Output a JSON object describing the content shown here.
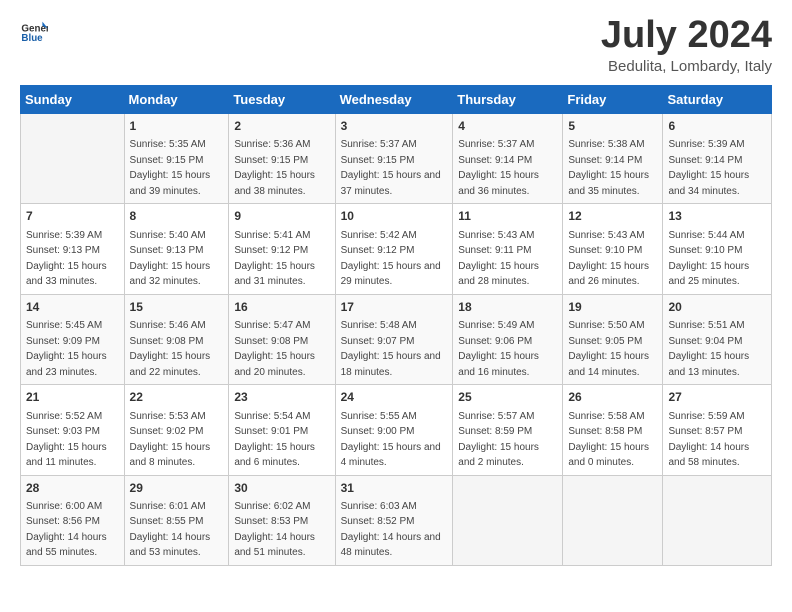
{
  "header": {
    "logo_general": "General",
    "logo_blue": "Blue",
    "month_title": "July 2024",
    "location": "Bedulita, Lombardy, Italy"
  },
  "days_of_week": [
    "Sunday",
    "Monday",
    "Tuesday",
    "Wednesday",
    "Thursday",
    "Friday",
    "Saturday"
  ],
  "weeks": [
    [
      {
        "num": "",
        "sunrise": "",
        "sunset": "",
        "daylight": "",
        "empty": true
      },
      {
        "num": "1",
        "sunrise": "Sunrise: 5:35 AM",
        "sunset": "Sunset: 9:15 PM",
        "daylight": "Daylight: 15 hours and 39 minutes."
      },
      {
        "num": "2",
        "sunrise": "Sunrise: 5:36 AM",
        "sunset": "Sunset: 9:15 PM",
        "daylight": "Daylight: 15 hours and 38 minutes."
      },
      {
        "num": "3",
        "sunrise": "Sunrise: 5:37 AM",
        "sunset": "Sunset: 9:15 PM",
        "daylight": "Daylight: 15 hours and 37 minutes."
      },
      {
        "num": "4",
        "sunrise": "Sunrise: 5:37 AM",
        "sunset": "Sunset: 9:14 PM",
        "daylight": "Daylight: 15 hours and 36 minutes."
      },
      {
        "num": "5",
        "sunrise": "Sunrise: 5:38 AM",
        "sunset": "Sunset: 9:14 PM",
        "daylight": "Daylight: 15 hours and 35 minutes."
      },
      {
        "num": "6",
        "sunrise": "Sunrise: 5:39 AM",
        "sunset": "Sunset: 9:14 PM",
        "daylight": "Daylight: 15 hours and 34 minutes."
      }
    ],
    [
      {
        "num": "7",
        "sunrise": "Sunrise: 5:39 AM",
        "sunset": "Sunset: 9:13 PM",
        "daylight": "Daylight: 15 hours and 33 minutes."
      },
      {
        "num": "8",
        "sunrise": "Sunrise: 5:40 AM",
        "sunset": "Sunset: 9:13 PM",
        "daylight": "Daylight: 15 hours and 32 minutes."
      },
      {
        "num": "9",
        "sunrise": "Sunrise: 5:41 AM",
        "sunset": "Sunset: 9:12 PM",
        "daylight": "Daylight: 15 hours and 31 minutes."
      },
      {
        "num": "10",
        "sunrise": "Sunrise: 5:42 AM",
        "sunset": "Sunset: 9:12 PM",
        "daylight": "Daylight: 15 hours and 29 minutes."
      },
      {
        "num": "11",
        "sunrise": "Sunrise: 5:43 AM",
        "sunset": "Sunset: 9:11 PM",
        "daylight": "Daylight: 15 hours and 28 minutes."
      },
      {
        "num": "12",
        "sunrise": "Sunrise: 5:43 AM",
        "sunset": "Sunset: 9:10 PM",
        "daylight": "Daylight: 15 hours and 26 minutes."
      },
      {
        "num": "13",
        "sunrise": "Sunrise: 5:44 AM",
        "sunset": "Sunset: 9:10 PM",
        "daylight": "Daylight: 15 hours and 25 minutes."
      }
    ],
    [
      {
        "num": "14",
        "sunrise": "Sunrise: 5:45 AM",
        "sunset": "Sunset: 9:09 PM",
        "daylight": "Daylight: 15 hours and 23 minutes."
      },
      {
        "num": "15",
        "sunrise": "Sunrise: 5:46 AM",
        "sunset": "Sunset: 9:08 PM",
        "daylight": "Daylight: 15 hours and 22 minutes."
      },
      {
        "num": "16",
        "sunrise": "Sunrise: 5:47 AM",
        "sunset": "Sunset: 9:08 PM",
        "daylight": "Daylight: 15 hours and 20 minutes."
      },
      {
        "num": "17",
        "sunrise": "Sunrise: 5:48 AM",
        "sunset": "Sunset: 9:07 PM",
        "daylight": "Daylight: 15 hours and 18 minutes."
      },
      {
        "num": "18",
        "sunrise": "Sunrise: 5:49 AM",
        "sunset": "Sunset: 9:06 PM",
        "daylight": "Daylight: 15 hours and 16 minutes."
      },
      {
        "num": "19",
        "sunrise": "Sunrise: 5:50 AM",
        "sunset": "Sunset: 9:05 PM",
        "daylight": "Daylight: 15 hours and 14 minutes."
      },
      {
        "num": "20",
        "sunrise": "Sunrise: 5:51 AM",
        "sunset": "Sunset: 9:04 PM",
        "daylight": "Daylight: 15 hours and 13 minutes."
      }
    ],
    [
      {
        "num": "21",
        "sunrise": "Sunrise: 5:52 AM",
        "sunset": "Sunset: 9:03 PM",
        "daylight": "Daylight: 15 hours and 11 minutes."
      },
      {
        "num": "22",
        "sunrise": "Sunrise: 5:53 AM",
        "sunset": "Sunset: 9:02 PM",
        "daylight": "Daylight: 15 hours and 8 minutes."
      },
      {
        "num": "23",
        "sunrise": "Sunrise: 5:54 AM",
        "sunset": "Sunset: 9:01 PM",
        "daylight": "Daylight: 15 hours and 6 minutes."
      },
      {
        "num": "24",
        "sunrise": "Sunrise: 5:55 AM",
        "sunset": "Sunset: 9:00 PM",
        "daylight": "Daylight: 15 hours and 4 minutes."
      },
      {
        "num": "25",
        "sunrise": "Sunrise: 5:57 AM",
        "sunset": "Sunset: 8:59 PM",
        "daylight": "Daylight: 15 hours and 2 minutes."
      },
      {
        "num": "26",
        "sunrise": "Sunrise: 5:58 AM",
        "sunset": "Sunset: 8:58 PM",
        "daylight": "Daylight: 15 hours and 0 minutes."
      },
      {
        "num": "27",
        "sunrise": "Sunrise: 5:59 AM",
        "sunset": "Sunset: 8:57 PM",
        "daylight": "Daylight: 14 hours and 58 minutes."
      }
    ],
    [
      {
        "num": "28",
        "sunrise": "Sunrise: 6:00 AM",
        "sunset": "Sunset: 8:56 PM",
        "daylight": "Daylight: 14 hours and 55 minutes."
      },
      {
        "num": "29",
        "sunrise": "Sunrise: 6:01 AM",
        "sunset": "Sunset: 8:55 PM",
        "daylight": "Daylight: 14 hours and 53 minutes."
      },
      {
        "num": "30",
        "sunrise": "Sunrise: 6:02 AM",
        "sunset": "Sunset: 8:53 PM",
        "daylight": "Daylight: 14 hours and 51 minutes."
      },
      {
        "num": "31",
        "sunrise": "Sunrise: 6:03 AM",
        "sunset": "Sunset: 8:52 PM",
        "daylight": "Daylight: 14 hours and 48 minutes."
      },
      {
        "num": "",
        "sunrise": "",
        "sunset": "",
        "daylight": "",
        "empty": true
      },
      {
        "num": "",
        "sunrise": "",
        "sunset": "",
        "daylight": "",
        "empty": true
      },
      {
        "num": "",
        "sunrise": "",
        "sunset": "",
        "daylight": "",
        "empty": true
      }
    ]
  ]
}
